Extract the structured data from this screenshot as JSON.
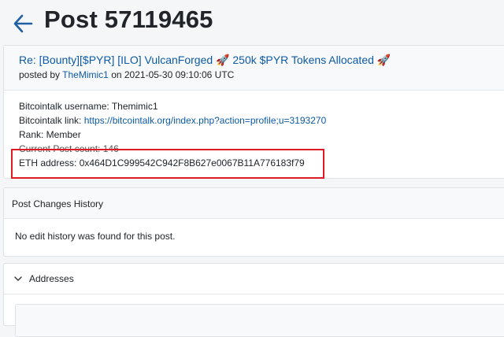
{
  "page": {
    "title": "Post 57119465"
  },
  "post": {
    "link_text": "Re: [Bounty][$PYR] [ILO] VulcanForged 🚀 250k $PYR Tokens Allocated 🚀",
    "posted_by_label": "posted by",
    "author": "TheMimic1",
    "posted_on": "on 2021-05-30 09:10:06 UTC",
    "lines": {
      "username_label": "Bitcointalk username: Themimic1",
      "link_label": "Bitcointalk link: ",
      "link_url": "https://bitcointalk.org/index.php?action=profile;u=3193270",
      "rank": "Rank: Member",
      "post_count": "Current Post count: 146",
      "eth": "ETH address: 0x464D1C999542C942F8B627e0067B11A776183f79"
    }
  },
  "history": {
    "title": "Post Changes History",
    "empty_text": "No edit history was found for this post."
  },
  "addresses": {
    "title": "Addresses"
  },
  "colors": {
    "link": "#0d5aa7",
    "highlight": "#e01b24",
    "back_arrow": "#1f5fa3"
  }
}
